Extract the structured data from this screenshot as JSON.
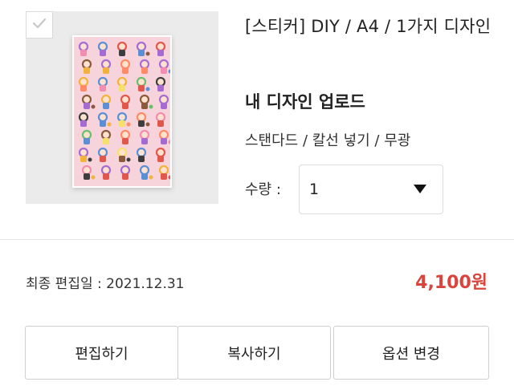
{
  "product": {
    "title": "[스티커] DIY / A4 / 1가지 디자인",
    "upload_label": "내 디자인 업로드",
    "options": "스탠다드 / 칼선 넣기 / 무광",
    "quantity_label": "수량 :",
    "quantity_value": "1",
    "thumbnail_icon": "sticker-sheet-image",
    "checkbox_icon": "check-icon"
  },
  "summary": {
    "last_edited": "최종 편집일 : 2021.12.31",
    "price": "4,100원"
  },
  "actions": {
    "edit_label": "편집하기",
    "copy_label": "복사하기",
    "change_option_label": "옵션 변경"
  },
  "colors": {
    "price": "#d9453d",
    "sheet_background": "#f7d3db",
    "thumbnail_background": "#ebebeb"
  }
}
